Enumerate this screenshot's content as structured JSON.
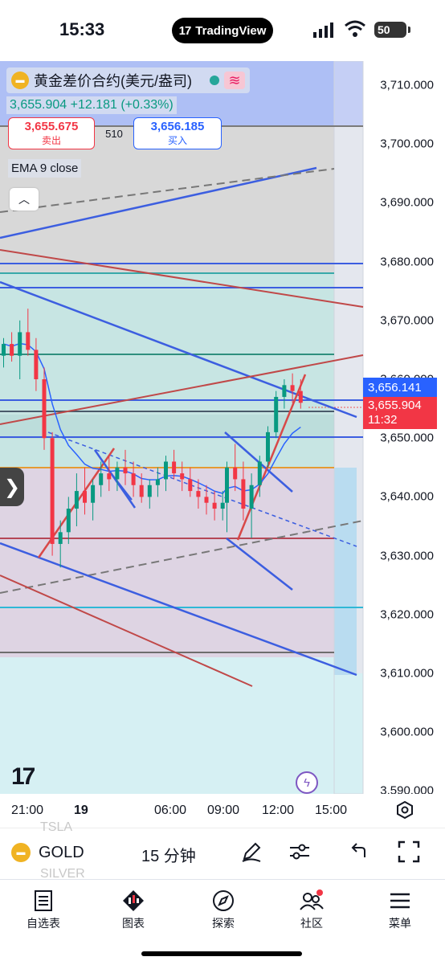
{
  "status_bar": {
    "time": "15:33",
    "app_badge": "TradingView",
    "battery": "50"
  },
  "legend": {
    "symbol_name": "黄金差价合约(美元/盎司)",
    "price_line": "3,655.904 +12.181 (+0.33%)",
    "sell_price": "3,655.675",
    "sell_label": "卖出",
    "spread": "510",
    "buy_price": "3,656.185",
    "buy_label": "买入",
    "indicator": "EMA 9 close",
    "up_color": "#089981",
    "down_color": "#f23645"
  },
  "price_axis": {
    "labels": [
      "3,710.000",
      "3,700.000",
      "3,690.000",
      "3,680.000",
      "3,670.000",
      "3,660.000",
      "3,650.000",
      "3,640.000",
      "3,630.000",
      "3,620.000",
      "3,610.000",
      "3,600.000",
      "3,590.000"
    ],
    "blue_tag": "3,656.141",
    "red_tag_price": "3,655.904",
    "red_tag_countdown": "11:32"
  },
  "time_axis": {
    "labels": [
      "21:00",
      "19",
      "06:00",
      "09:00",
      "12:00",
      "15:00"
    ]
  },
  "toolbar": {
    "symbol": "GOLD",
    "interval": "15 分钟",
    "ghost_above": "TSLA",
    "ghost_below": "SILVER",
    "icons": [
      "pen-icon",
      "sliders-icon",
      "undo-icon",
      "fullscreen-icon"
    ]
  },
  "tabs": [
    {
      "label": "自选表",
      "icon": "watchlist-icon"
    },
    {
      "label": "图表",
      "icon": "chart-icon"
    },
    {
      "label": "探索",
      "icon": "compass-icon"
    },
    {
      "label": "社区",
      "icon": "community-icon"
    },
    {
      "label": "菜单",
      "icon": "menu-icon"
    }
  ],
  "chart_data": {
    "type": "candlestick",
    "symbol": "GOLD",
    "interval": "15 分钟",
    "ylim": [
      3590,
      3712
    ],
    "x_tick_labels": [
      "21:00",
      "19",
      "06:00",
      "09:00",
      "12:00",
      "15:00"
    ],
    "last_price": 3655.904,
    "ema_last": 3656.141,
    "candles": [
      [
        3664,
        3667,
        3662,
        3666
      ],
      [
        3666,
        3668,
        3663,
        3664
      ],
      [
        3664,
        3670,
        3660,
        3668
      ],
      [
        3668,
        3672,
        3664,
        3665
      ],
      [
        3665,
        3667,
        3658,
        3660
      ],
      [
        3660,
        3662,
        3648,
        3650
      ],
      [
        3650,
        3651,
        3630,
        3632
      ],
      [
        3632,
        3636,
        3628,
        3634
      ],
      [
        3634,
        3640,
        3632,
        3638
      ],
      [
        3638,
        3644,
        3635,
        3641
      ],
      [
        3641,
        3645,
        3637,
        3639
      ],
      [
        3639,
        3643,
        3636,
        3642
      ],
      [
        3642,
        3646,
        3640,
        3644
      ],
      [
        3644,
        3647,
        3641,
        3643
      ],
      [
        3643,
        3646,
        3641,
        3645
      ],
      [
        3645,
        3648,
        3642,
        3644
      ],
      [
        3644,
        3646,
        3640,
        3642
      ],
      [
        3642,
        3644,
        3639,
        3640
      ],
      [
        3640,
        3643,
        3638,
        3642
      ],
      [
        3642,
        3645,
        3640,
        3643
      ],
      [
        3643,
        3647,
        3641,
        3646
      ],
      [
        3646,
        3648,
        3643,
        3644
      ],
      [
        3644,
        3646,
        3641,
        3643
      ],
      [
        3643,
        3645,
        3640,
        3641
      ],
      [
        3641,
        3643,
        3638,
        3640
      ],
      [
        3640,
        3642,
        3637,
        3639
      ],
      [
        3639,
        3641,
        3636,
        3638
      ],
      [
        3638,
        3641,
        3636,
        3639
      ],
      [
        3639,
        3646,
        3634,
        3645
      ],
      [
        3645,
        3649,
        3641,
        3643
      ],
      [
        3643,
        3646,
        3636,
        3638
      ],
      [
        3638,
        3644,
        3633,
        3642
      ],
      [
        3642,
        3647,
        3640,
        3646
      ],
      [
        3646,
        3652,
        3645,
        3651
      ],
      [
        3651,
        3658,
        3650,
        3657
      ],
      [
        3657,
        3660,
        3655,
        3659
      ],
      [
        3659,
        3661,
        3656,
        3658
      ],
      [
        3658,
        3660,
        3655,
        3656
      ]
    ]
  }
}
